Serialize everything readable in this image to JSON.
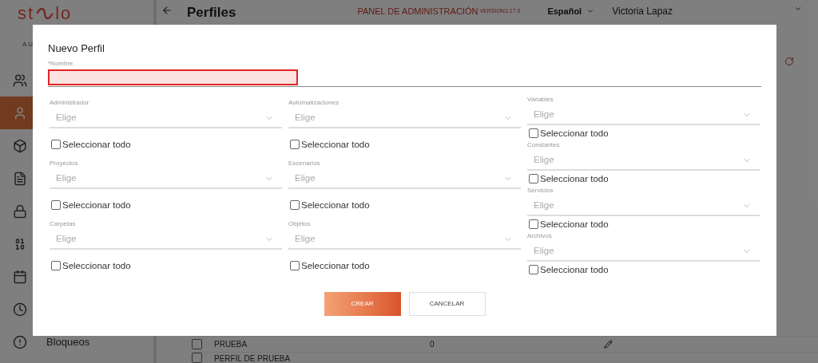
{
  "background": {
    "logo": {
      "left": "st",
      "right": "lo",
      "tagline": "AU"
    },
    "sidebar": {
      "items": [
        {
          "selected": false
        },
        {
          "selected": true
        },
        {
          "selected": false
        },
        {
          "selected": false
        },
        {
          "selected": false
        },
        {
          "selected": false
        },
        {
          "selected": false
        },
        {
          "selected": false
        },
        {
          "label": "Bloqueos",
          "selected": false
        }
      ]
    },
    "header": {
      "title": "Perfiles",
      "panel": "PANEL DE ADMINISTRACIÓN",
      "version": "VERSION3.17.0",
      "language": "Español",
      "user": "Victoria Lapaz"
    },
    "table": {
      "rows": [
        {
          "name": "PRUEBA",
          "column_2": "0",
          "checked": false
        },
        {
          "name": "PERFIL DE PRUEBA",
          "checked": false
        }
      ]
    }
  },
  "dialog": {
    "title": "Nuevo Perfil",
    "name_field": {
      "label": "*Nombre",
      "invalid": true
    },
    "columns": [
      {
        "fields": [
          {
            "label": "Administrador",
            "placeholder": "Elige",
            "select_all": {
              "label": "Seleccionar todo",
              "checked": false
            }
          },
          {
            "label": "Proyectos",
            "placeholder": "Elige",
            "select_all": {
              "label": "Seleccionar todo",
              "checked": false
            }
          },
          {
            "label": "Carpetas",
            "placeholder": "Elige",
            "select_all": {
              "label": "Seleccionar todo",
              "checked": false
            }
          }
        ]
      },
      {
        "fields": [
          {
            "label": "Automatizaciones",
            "placeholder": "Elige",
            "select_all": {
              "label": "Seleccionar todo",
              "checked": false
            }
          },
          {
            "label": "Escenarios",
            "placeholder": "Elige",
            "select_all": {
              "label": "Seleccionar todo",
              "checked": false
            }
          },
          {
            "label": "Objetos",
            "placeholder": "Elige",
            "select_all": {
              "label": "Seleccionar todo",
              "checked": false
            }
          }
        ]
      },
      {
        "fields": [
          {
            "label": "Variables",
            "placeholder": "Elige",
            "select_all": {
              "label": "Seleccionar todo",
              "checked": false
            }
          },
          {
            "label": "Constantes",
            "placeholder": "Elige",
            "select_all": {
              "label": "Seleccionar todo",
              "checked": false
            }
          },
          {
            "label": "Servicios",
            "placeholder": "Elige",
            "select_all": {
              "label": "Seleccionar todo",
              "checked": false
            }
          },
          {
            "label": "Archivos",
            "placeholder": "Elige",
            "select_all": {
              "label": "Seleccionar todo",
              "checked": false
            }
          }
        ]
      }
    ],
    "buttons": [
      {
        "label": "CREAR",
        "kind": "primary"
      },
      {
        "label": "CANCELAR",
        "kind": "secondary"
      }
    ]
  }
}
